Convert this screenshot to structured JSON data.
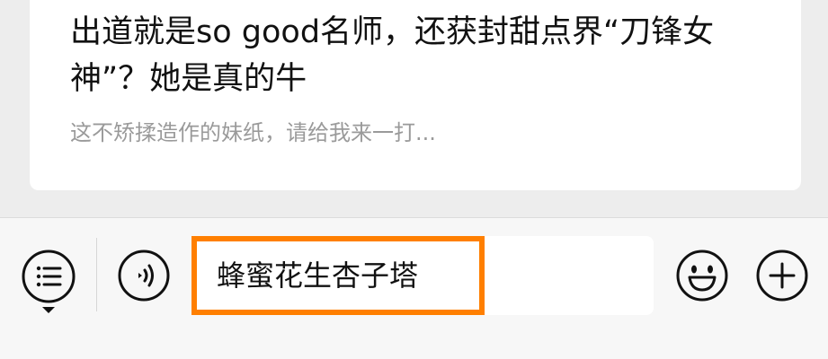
{
  "article": {
    "title": "出道就是so good名师，还获封甜点界“刀锋女神”？她是真的牛",
    "summary": "这不矫揉造作的妹纸，请给我来一打..."
  },
  "input_bar": {
    "text_value": "蜂蜜花生杏子塔",
    "menu_icon": "list-menu-icon",
    "voice_icon": "voice-icon",
    "emoji_icon": "emoji-icon",
    "plus_icon": "plus-icon",
    "highlight_color": "#ff7f00"
  }
}
